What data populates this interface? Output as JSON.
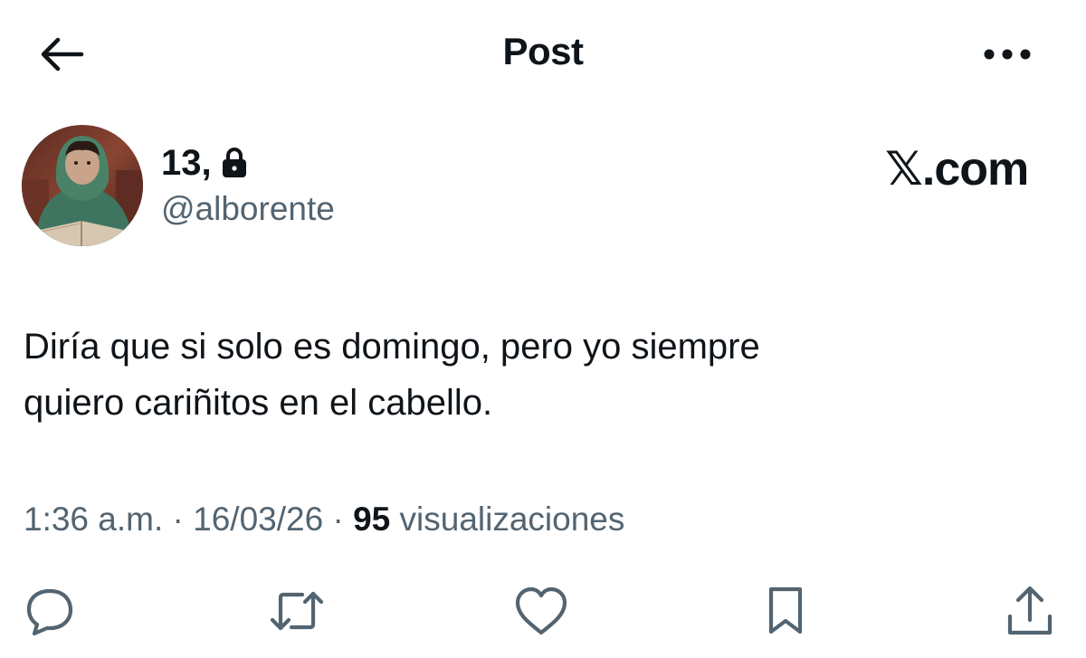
{
  "header": {
    "title": "Post",
    "back_icon": "arrow-left-icon",
    "more_icon": "more-horizontal-icon"
  },
  "author": {
    "display_name": "13,",
    "protected_icon": "lock-icon",
    "handle": "@alborente",
    "avatar": "profile-photo"
  },
  "brand": {
    "logo_text": "𝕏.com"
  },
  "post": {
    "text_line1": "Diría que si solo es domingo, pero yo siempre",
    "text_line2": "quiero cariñitos en el cabello.",
    "time": "1:36 a.m.",
    "separator": "·",
    "date": "16/03/26",
    "views_count": "95",
    "views_label": "visualizaciones"
  },
  "actions": [
    {
      "name": "reply",
      "icon": "reply-icon"
    },
    {
      "name": "repost",
      "icon": "repost-icon"
    },
    {
      "name": "like",
      "icon": "heart-icon"
    },
    {
      "name": "bookmark",
      "icon": "bookmark-icon"
    },
    {
      "name": "share",
      "icon": "share-icon"
    }
  ],
  "colors": {
    "text": "#0f1419",
    "secondary": "#536471",
    "background": "#ffffff"
  }
}
